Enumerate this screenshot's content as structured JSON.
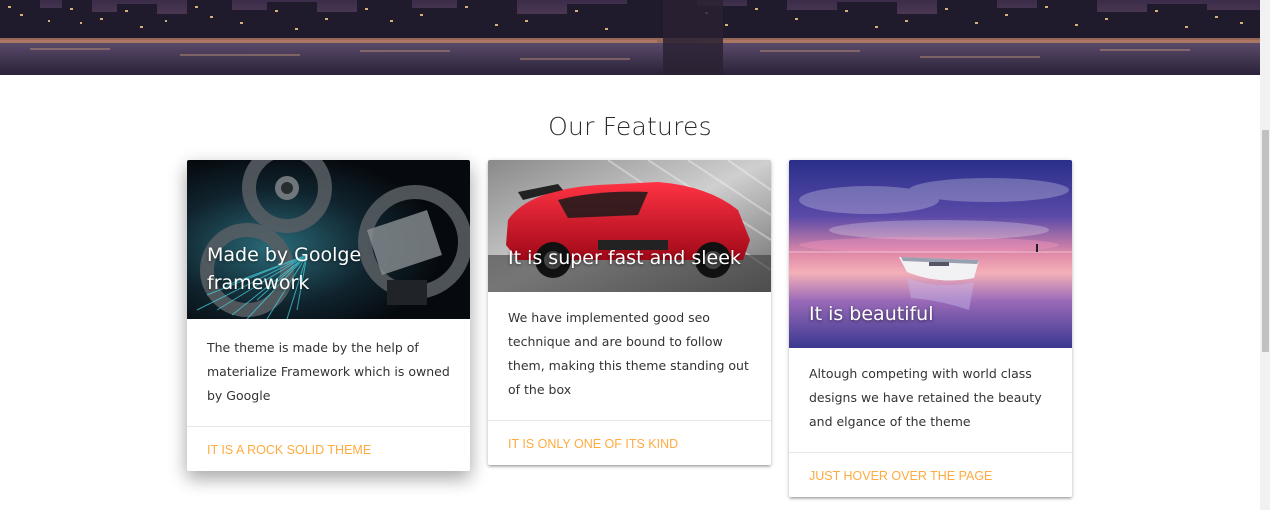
{
  "section": {
    "title": "Our Features"
  },
  "cards": [
    {
      "title": "Made by Goolge framework",
      "body": "The theme is made by the help of materialize Framework which is owned by Google",
      "action": "IT IS A ROCK SOLID THEME"
    },
    {
      "title": "It is super fast and sleek",
      "body": "We have implemented good seo technique and are bound to follow them, making this theme standing out of the box",
      "action": "IT IS ONLY ONE OF ITS KIND"
    },
    {
      "title": "It is beautiful",
      "body": "Altough competing with world class designs we have retained the beauty and elgance of the theme",
      "action": "JUST HOVER OVER THE PAGE"
    }
  ],
  "theme": {
    "link_color": "#ffab40",
    "title_color": "#2b2b2b"
  }
}
